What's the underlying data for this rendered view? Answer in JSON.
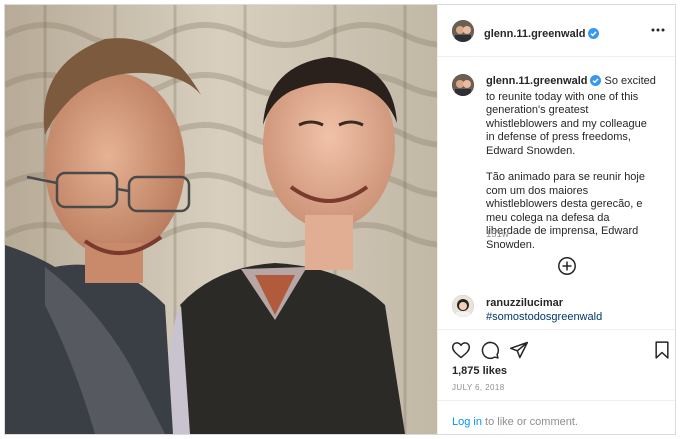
{
  "post": {
    "username": "glenn.11.greenwald",
    "caption_en": "So excited to reunite today with one of this generation's greatest whistleblowers and my colleague in defense of press freedoms, Edward Snowden.",
    "caption_pt": "Tão animado para se reunir hoje com um dos maiores whistleblowers desta gerecão, e meu colega na defesa da liberdade de imprensa, Edward Snowden.",
    "time_ago": "151w",
    "likes": "1,875 likes",
    "date": "JULY 6, 2018"
  },
  "comment": {
    "username": "ranuzzilucimar",
    "text": "#somostodosgreenwald"
  },
  "login": {
    "link": "Log in",
    "rest": " to like or comment."
  },
  "icons": {
    "verified": "verified-badge-icon",
    "more": "more-options-icon",
    "add_comments": "plus-circle-icon",
    "like": "heart-icon",
    "comment": "comment-icon",
    "share": "share-icon",
    "save": "bookmark-icon"
  },
  "colors": {
    "verified": "#3897f0",
    "link": "#0095f6",
    "hashtag": "#00376b",
    "muted": "#8e8e8e"
  }
}
